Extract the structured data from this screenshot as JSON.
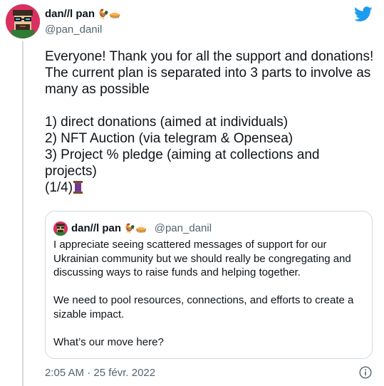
{
  "author": {
    "display_name": "dan//l pan",
    "name_emojis": "🐓🥧",
    "handle": "@pan_danil",
    "avatar_icon": "pixel-punk-avatar"
  },
  "tweet": {
    "lines": [
      "Everyone! Thank you for all the support and donations! The current plan is separated into 3 parts to involve as many as possible",
      "",
      "1) direct donations (aimed at individuals)",
      "2) NFT Auction (via telegram & Opensea)",
      "3) Project % pledge (aiming at collections and projects)",
      "(1/4)"
    ],
    "thread_emoji_icon": "thread-spool-icon",
    "timestamp": "2:05 AM · 25 févr. 2022"
  },
  "quoted_tweet": {
    "display_name": "dan//l pan",
    "name_emojis": "🐓🥧",
    "handle": "@pan_danil",
    "paragraphs": [
      "I appreciate seeing scattered messages of support for our Ukrainian community but we should really be congregating and discussing ways to raise funds and helping together.",
      "We need to pool resources, connections, and efforts to create a sizable impact.",
      "What’s our move here?"
    ]
  },
  "colors": {
    "twitter_blue": "#1d9bf0",
    "text_primary": "#0f1419",
    "text_secondary": "#536471",
    "border": "#cfd9de",
    "avatar_bg": "#d9315f"
  },
  "icons": [
    "twitter-bird-icon",
    "info-icon",
    "thread-spool-icon"
  ]
}
